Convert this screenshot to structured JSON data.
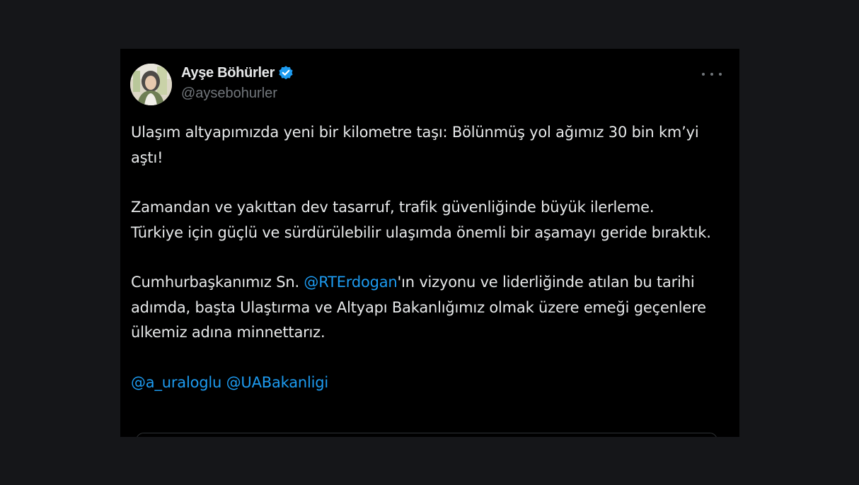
{
  "author": {
    "display_name": "Ayşe Böhürler",
    "handle": "@aysebohurler",
    "verified_icon": "verified-badge-icon",
    "avatar_icon": "profile-photo"
  },
  "menu": {
    "more_icon": "more-options-icon"
  },
  "tweet": {
    "p1": "Ulaşım altyapımızda yeni bir kilometre taşı: Bölünmüş yol ağımız 30 bin km’yi aştı!",
    "p2_line1": "Zamandan ve yakıttan dev tasarruf, trafik güvenliğinde büyük ilerleme.",
    "p2_line2": "Türkiye için güçlü ve sürdürülebilir ulaşımda önemli bir aşamayı geride bıraktık.",
    "p3_prefix": "Cumhurbaşkanımız Sn. ",
    "p3_mention": "@RTErdogan",
    "p3_suffix": "'ın vizyonu ve liderliğinde atılan bu tarihi adımda, başta Ulaştırma ve Altyapı Bakanlığımız olmak üzere emeği geçenlere ülkemiz adına minnettarız.",
    "mention_1": "@a_uraloglu",
    "mention_2": "@UABakanligi"
  },
  "colors": {
    "page_background": "#151619",
    "card_background": "#000000",
    "text_primary": "#e7e9ea",
    "text_secondary": "#71767b",
    "accent": "#1d9bf0"
  }
}
